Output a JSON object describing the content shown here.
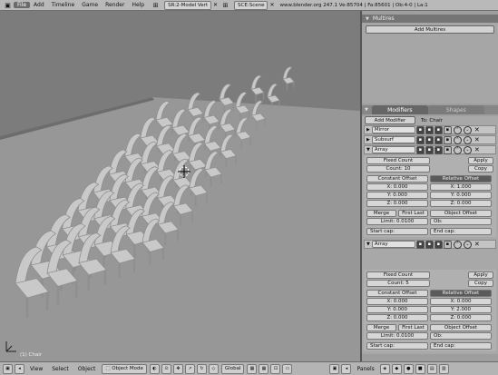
{
  "topbar": {
    "menus": [
      "File",
      "Add",
      "Timeline",
      "Game",
      "Render",
      "Help"
    ],
    "screen_field": "SR:2-Model",
    "screen_suffix": "Vert",
    "scene_field": "SCE:Scene",
    "info": "www.blender.org 247.1  Ve:85704 | Fa:85601 | Ob:4-0 | La:1"
  },
  "viewport": {
    "object_label": "(1) Chair",
    "colors": {
      "background": "#7c7c7c",
      "floor": "#979797",
      "chair": "#c9c9c9",
      "chair_shade": "#8f8f8f"
    }
  },
  "panel": {
    "multires": {
      "title": "Multires",
      "add_button": "Add Multires"
    },
    "tabs": [
      "Modifiers",
      "Shapes"
    ],
    "add_modifier": "Add Modifier",
    "to_label": "To: Chair",
    "modifiers": [
      {
        "name": "Mirror"
      },
      {
        "name": "Subsurf"
      },
      {
        "name": "Array"
      }
    ],
    "array1": {
      "fit_type": "Fixed Count",
      "count": "Count: 10",
      "apply": "Apply",
      "copy": "Copy",
      "constant_offset": "Constant Offset",
      "relative_offset": "Relative Offset",
      "const_x": "X: 0.000",
      "const_y": "Y: 0.000",
      "const_z": "Z: 0.000",
      "rel_x": "X: 1.000",
      "rel_y": "Y: 0.000",
      "rel_z": "Z: 0.000",
      "merge": "Merge",
      "first_last": "First Last",
      "limit": "Limit: 0.0100",
      "object_offset": "Object Offset",
      "ob": "Ob:",
      "start_cap": "Start cap:",
      "end_cap": "End cap:"
    },
    "array2": {
      "name": "Array",
      "fit_type": "Fixed Count",
      "count": "Count: 5",
      "apply": "Apply",
      "copy": "Copy",
      "constant_offset": "Constant Offset",
      "relative_offset": "Relative Offset",
      "const_x": "X: 0.000",
      "const_y": "Y: 0.000",
      "const_z": "Z: 0.000",
      "rel_x": "X: 0.000",
      "rel_y": "Y: 2.000",
      "rel_z": "Z: 0.000",
      "merge": "Merge",
      "first_last": "First Last",
      "limit": "Limit: 0.0100",
      "object_offset": "Object Offset",
      "ob": "Ob:",
      "start_cap": "Start cap:",
      "end_cap": "End cap:"
    }
  },
  "bottombar": {
    "view": "View",
    "select": "Select",
    "object": "Object",
    "mode": "Object Mode",
    "orientation": "Global",
    "panels": "Panels"
  }
}
